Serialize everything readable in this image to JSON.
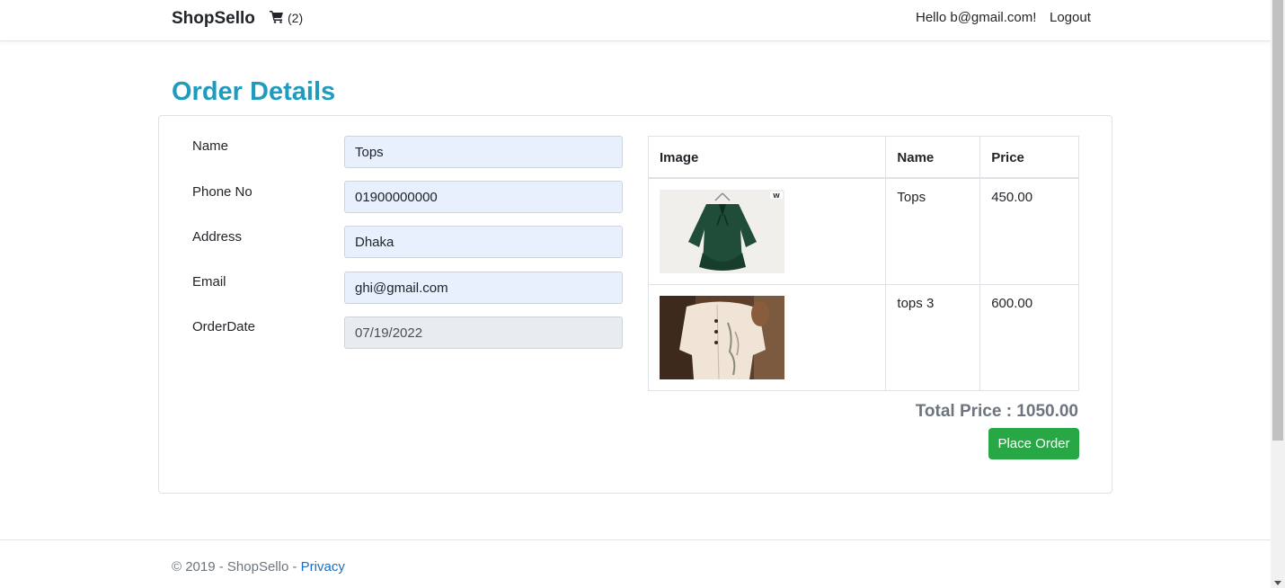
{
  "nav": {
    "brand": "ShopSello",
    "cart_count": "(2)",
    "greeting": "Hello b@gmail.com!",
    "logout": "Logout"
  },
  "page": {
    "title": "Order Details"
  },
  "form": {
    "fields": [
      {
        "label": "Name",
        "value": "Tops"
      },
      {
        "label": "Phone No",
        "value": "01900000000"
      },
      {
        "label": "Address",
        "value": "Dhaka"
      },
      {
        "label": "Email",
        "value": "ghi@gmail.com"
      },
      {
        "label": "OrderDate",
        "value": "07/19/2022"
      }
    ]
  },
  "table": {
    "headers": [
      "Image",
      "Name",
      "Price"
    ],
    "rows": [
      {
        "image": "green-top-product-image",
        "name": "Tops",
        "price": "450.00"
      },
      {
        "image": "white-top-product-image",
        "name": "tops 3",
        "price": "600.00"
      }
    ]
  },
  "summary": {
    "total": "Total Price : 1050.00",
    "place_order": "Place Order"
  },
  "footer": {
    "copyright": "© 2019 - ShopSello - ",
    "privacy": "Privacy"
  },
  "colors": {
    "title": "#1f9bbd",
    "button": "#28a745",
    "input_bg": "#e8f0fe",
    "link": "#1b6ec2"
  }
}
